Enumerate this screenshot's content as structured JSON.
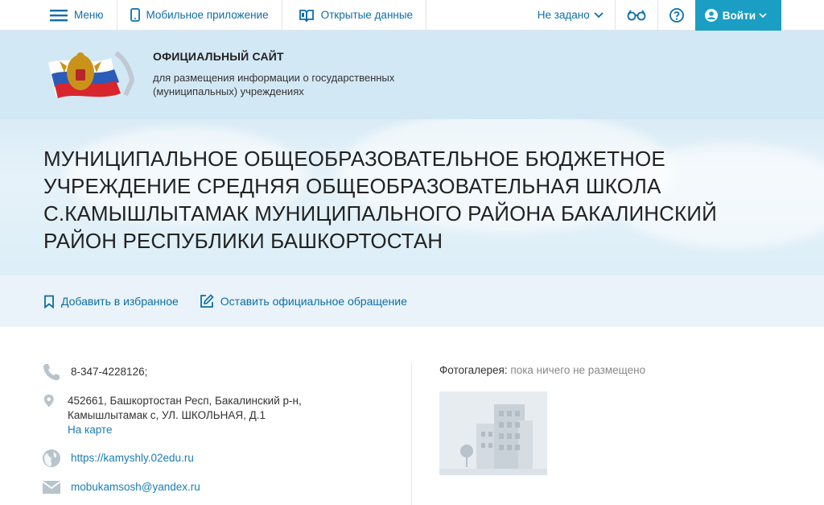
{
  "topnav": {
    "menu_label": "Меню",
    "mobile_label": "Мобильное приложение",
    "opendata_label": "Открытые данные",
    "region_label": "Не задано",
    "login_label": "Войти"
  },
  "header": {
    "site_title": "ОФИЦИАЛЬНЫЙ САЙТ",
    "site_subtitle": "для размещения информации о государственных (муниципальных) учреждениях"
  },
  "organization": {
    "name": "МУНИЦИПАЛЬНОЕ ОБЩЕОБРАЗОВАТЕЛЬНОЕ БЮДЖЕТНОЕ УЧРЕЖДЕНИЕ СРЕДНЯЯ ОБЩЕОБРАЗОВАТЕЛЬНАЯ ШКОЛА С.КАМЫШЛЫТАМАК МУНИЦИПАЛЬНОГО РАЙОНА БАКАЛИНСКИЙ РАЙОН РЕСПУБЛИКИ БАШКОРТОСТАН"
  },
  "actions": {
    "favorite_label": "Добавить в избранное",
    "appeal_label": "Оставить официальное обращение"
  },
  "contacts": {
    "phone": "8-347-4228126;",
    "address_line1": "452661, Башкортостан Респ, Бакалинский р-н,",
    "address_line2": "Камышлытамак с, УЛ. ШКОЛЬНАЯ, Д.1",
    "map_link": "На карте",
    "website": "https://kamyshly.02edu.ru",
    "email": "mobukamsosh@yandex.ru"
  },
  "gallery": {
    "label": "Фотогалерея:",
    "status": "пока ничего не размещено"
  },
  "colors": {
    "accent": "#0d6ea8",
    "login_bg": "#1a9ec4",
    "hero_bg": "#d3e8f5",
    "icon_gray": "#b7c4cc"
  }
}
